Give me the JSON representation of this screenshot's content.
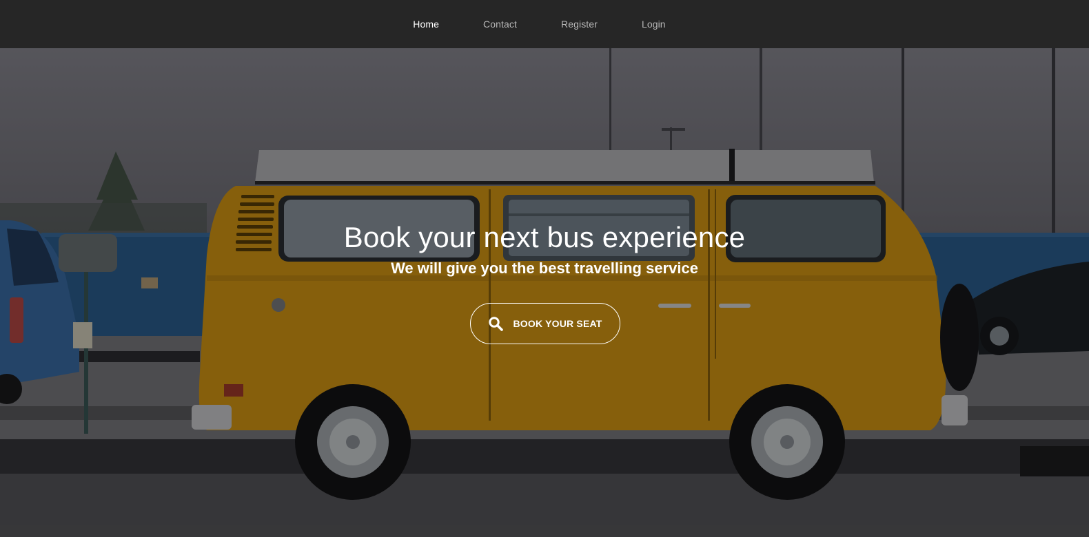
{
  "nav": {
    "items": [
      {
        "label": "Home",
        "active": true
      },
      {
        "label": "Contact",
        "active": false
      },
      {
        "label": "Register",
        "active": false
      },
      {
        "label": "Login",
        "active": false
      }
    ]
  },
  "hero": {
    "title": "Book your next bus experience",
    "subtitle": "We will give you the best travelling service",
    "cta": {
      "label": "BOOK YOUR SEAT",
      "icon": "search-icon"
    }
  },
  "colors": {
    "navbar_bg": "#262626",
    "nav_link": "#b8b8b8",
    "nav_link_active": "#ffffff",
    "bus_yellow": "#d99a14",
    "fence_blue": "#2c5f92",
    "text": "#ffffff"
  }
}
